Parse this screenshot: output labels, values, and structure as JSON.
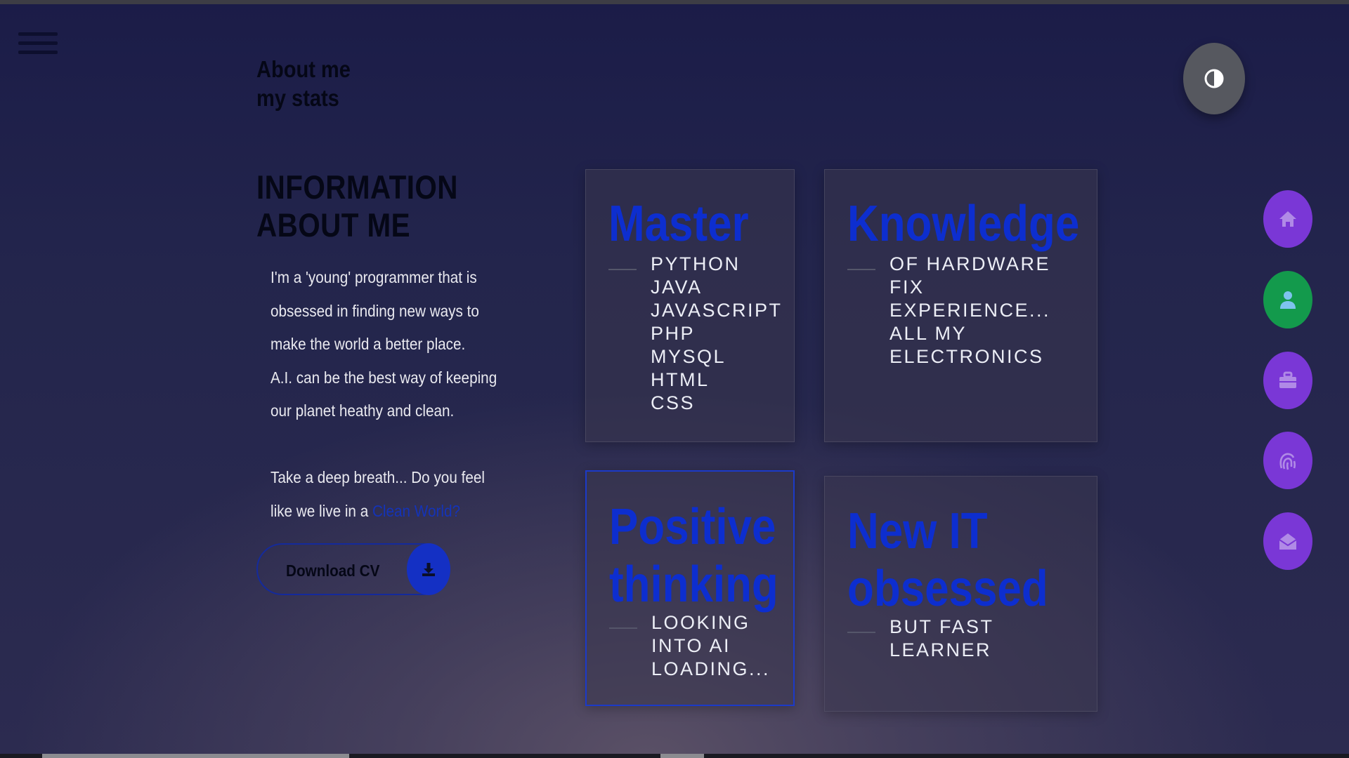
{
  "header": {
    "title_line1": "About me",
    "title_line2": "my stats"
  },
  "info": {
    "title_line1": "INFORMATION",
    "title_line2": "ABOUT ME",
    "bio_lines": [
      "I'm a 'young' programmer that is",
      "obsessed in finding new ways to",
      "make the world a better place.",
      "A.I. can be the best way of keeping",
      "our planet heathy and clean."
    ],
    "question_line1": "Take a deep breath... Do you feel",
    "question_line2_prefix": "like we live in a ",
    "question_link": "Clean World?",
    "link_color": "#1433b8"
  },
  "download": {
    "label": "Download CV",
    "icon": "download-icon"
  },
  "cards": [
    {
      "title": "Master",
      "items": [
        "PYTHON",
        "JAVA",
        "JAVASCRIPT",
        "PHP",
        "MYSQL",
        "HTML",
        "CSS"
      ]
    },
    {
      "title": "Knowledge",
      "items": [
        "OF HARDWARE",
        "FIX",
        "EXPERIENCE...",
        "ALL MY",
        "ELECTRONICS"
      ]
    },
    {
      "title_line1": "Positive",
      "title_line2": "thinking",
      "items": [
        "LOOKING",
        "INTO AI",
        "LOADING..."
      ]
    },
    {
      "title_line1": "New IT",
      "title_line2": "obsessed",
      "items": [
        "BUT FAST",
        "LEARNER"
      ]
    }
  ],
  "theme_toggle": {
    "icon": "contrast-icon"
  },
  "side_nav": [
    {
      "icon": "home-icon",
      "color": "#7a37d6"
    },
    {
      "icon": "user-icon",
      "color": "#139a4c"
    },
    {
      "icon": "briefcase-icon",
      "color": "#7a37d6"
    },
    {
      "icon": "fingerprint-icon",
      "color": "#7a37d6"
    },
    {
      "icon": "mail-open-icon",
      "color": "#7a37d6"
    }
  ],
  "colors": {
    "accent_blue": "#0d2ecf",
    "nav_purple": "#7a37d6",
    "nav_green": "#139a4c"
  }
}
